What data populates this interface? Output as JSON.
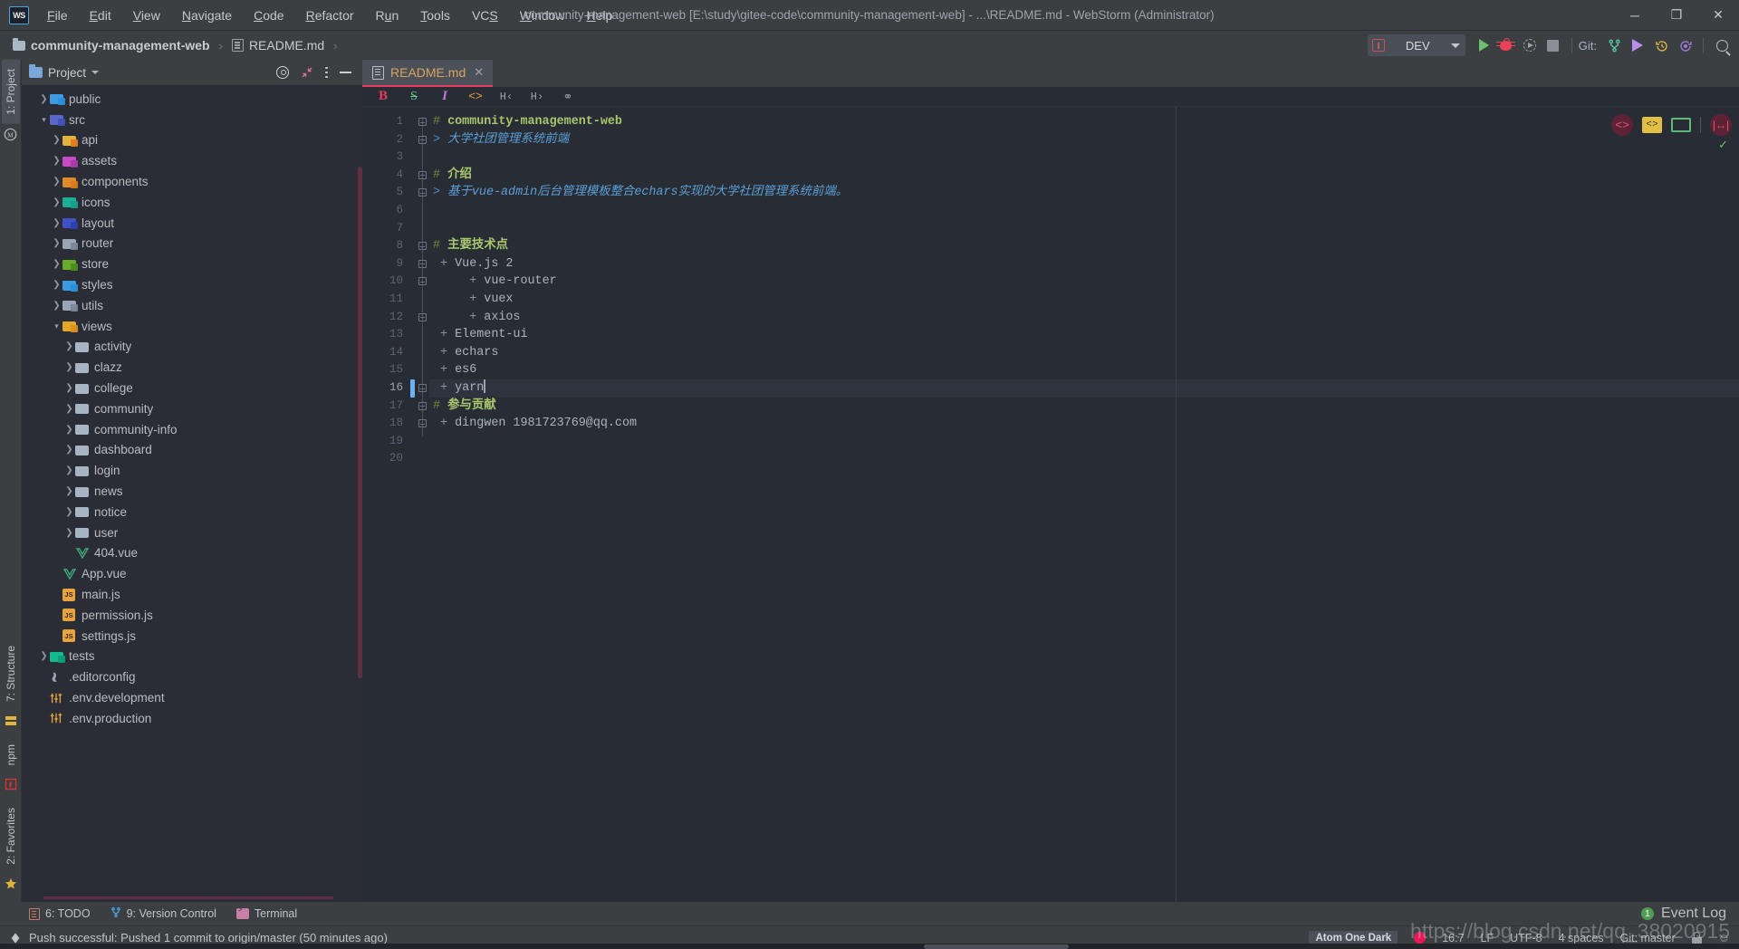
{
  "window": {
    "title": "community-management-web [E:\\study\\gitee-code\\community-management-web] - ...\\README.md - WebStorm (Administrator)",
    "logo": "WS",
    "minimize": "─",
    "maximize": "❐",
    "close": "✕"
  },
  "menubar": [
    {
      "label": "File"
    },
    {
      "label": "Edit"
    },
    {
      "label": "View"
    },
    {
      "label": "Navigate"
    },
    {
      "label": "Code"
    },
    {
      "label": "Refactor"
    },
    {
      "label": "Run"
    },
    {
      "label": "Tools"
    },
    {
      "label": "VCS"
    },
    {
      "label": "Window"
    },
    {
      "label": "Help"
    }
  ],
  "breadcrumb": {
    "project": "community-management-web",
    "file": "README.md",
    "sep": "›"
  },
  "toolbar": {
    "run_config": "DEV",
    "git_label": "Git:",
    "icons": [
      "run-icon",
      "debug-icon",
      "coverage-icon",
      "stop-icon",
      "branch-icon",
      "push-icon",
      "history-icon",
      "revert-icon",
      "search-everywhere-icon"
    ]
  },
  "left_strip": {
    "top": [
      {
        "label": "1: Project",
        "active": true
      }
    ],
    "bottom": [
      {
        "label": "7: Structure"
      },
      {
        "label": "npm"
      },
      {
        "label": "2: Favorites"
      }
    ]
  },
  "project_panel": {
    "title": "Project",
    "actions": [
      "locate-icon",
      "collapse-all-icon",
      "options-icon",
      "hide-icon"
    ],
    "tree": [
      {
        "label": "public",
        "indent": 1,
        "arrow": "closed",
        "icon": "folder",
        "color": "#3d9ae0",
        "badge": "globe"
      },
      {
        "label": "src",
        "indent": 1,
        "arrow": "open",
        "icon": "folder",
        "color": "#5868c9",
        "badge": "code"
      },
      {
        "label": "api",
        "indent": 2,
        "arrow": "closed",
        "icon": "folder",
        "color": "#e0b33d",
        "badge": "dot"
      },
      {
        "label": "assets",
        "indent": 2,
        "arrow": "closed",
        "icon": "folder",
        "color": "#c44bc4",
        "badge": "img"
      },
      {
        "label": "components",
        "indent": 2,
        "arrow": "closed",
        "icon": "folder",
        "color": "#e08b2b",
        "badge": "grid"
      },
      {
        "label": "icons",
        "indent": 2,
        "arrow": "closed",
        "icon": "folder",
        "color": "#1fae93",
        "badge": "cir"
      },
      {
        "label": "layout",
        "indent": 2,
        "arrow": "closed",
        "icon": "folder",
        "color": "#3f51c4",
        "badge": "bars"
      },
      {
        "label": "router",
        "indent": 2,
        "arrow": "closed",
        "icon": "folder",
        "color": "#9aa6b5",
        "badge": "arw"
      },
      {
        "label": "store",
        "indent": 2,
        "arrow": "closed",
        "icon": "folder",
        "color": "#6aab2e",
        "badge": "st"
      },
      {
        "label": "styles",
        "indent": 2,
        "arrow": "closed",
        "icon": "folder",
        "color": "#3d9ae0",
        "badge": "css"
      },
      {
        "label": "utils",
        "indent": 2,
        "arrow": "closed",
        "icon": "folder",
        "color": "#9aa6b5",
        "badge": "ut"
      },
      {
        "label": "views",
        "indent": 2,
        "arrow": "open",
        "icon": "folder",
        "color": "#e0a72b",
        "badge": "vw"
      },
      {
        "label": "activity",
        "indent": 3,
        "arrow": "closed",
        "icon": "folder",
        "color": "#a7b4c4",
        "badge": ""
      },
      {
        "label": "clazz",
        "indent": 3,
        "arrow": "closed",
        "icon": "folder",
        "color": "#a7b4c4",
        "badge": ""
      },
      {
        "label": "college",
        "indent": 3,
        "arrow": "closed",
        "icon": "folder",
        "color": "#a7b4c4",
        "badge": ""
      },
      {
        "label": "community",
        "indent": 3,
        "arrow": "closed",
        "icon": "folder",
        "color": "#a7b4c4",
        "badge": ""
      },
      {
        "label": "community-info",
        "indent": 3,
        "arrow": "closed",
        "icon": "folder",
        "color": "#a7b4c4",
        "badge": ""
      },
      {
        "label": "dashboard",
        "indent": 3,
        "arrow": "closed",
        "icon": "folder",
        "color": "#a7b4c4",
        "badge": ""
      },
      {
        "label": "login",
        "indent": 3,
        "arrow": "closed",
        "icon": "folder",
        "color": "#a7b4c4",
        "badge": ""
      },
      {
        "label": "news",
        "indent": 3,
        "arrow": "closed",
        "icon": "folder",
        "color": "#a7b4c4",
        "badge": ""
      },
      {
        "label": "notice",
        "indent": 3,
        "arrow": "closed",
        "icon": "folder",
        "color": "#a7b4c4",
        "badge": ""
      },
      {
        "label": "user",
        "indent": 3,
        "arrow": "closed",
        "icon": "folder",
        "color": "#a7b4c4",
        "badge": ""
      },
      {
        "label": "404.vue",
        "indent": 3,
        "arrow": "none",
        "icon": "vue",
        "color": "#41b883",
        "badge": ""
      },
      {
        "label": "App.vue",
        "indent": 2,
        "arrow": "none",
        "icon": "vue",
        "color": "#41b883",
        "badge": ""
      },
      {
        "label": "main.js",
        "indent": 2,
        "arrow": "none",
        "icon": "js",
        "color": "#e8a33d",
        "badge": ""
      },
      {
        "label": "permission.js",
        "indent": 2,
        "arrow": "none",
        "icon": "js",
        "color": "#e8a33d",
        "badge": ""
      },
      {
        "label": "settings.js",
        "indent": 2,
        "arrow": "none",
        "icon": "js",
        "color": "#e8a33d",
        "badge": ""
      },
      {
        "label": "tests",
        "indent": 1,
        "arrow": "closed",
        "icon": "folder",
        "color": "#16b891",
        "badge": "ts"
      },
      {
        "label": ".editorconfig",
        "indent": 1,
        "arrow": "none",
        "icon": "cfg",
        "color": "#9aa6b5",
        "badge": ""
      },
      {
        "label": ".env.development",
        "indent": 1,
        "arrow": "none",
        "icon": "env",
        "color": "#e8a33d",
        "badge": ""
      },
      {
        "label": ".env.production",
        "indent": 1,
        "arrow": "none",
        "icon": "env",
        "color": "#e8a33d",
        "badge": ""
      }
    ]
  },
  "editor": {
    "tab": {
      "label": "README.md",
      "close": "✕"
    },
    "md_toolbar": [
      {
        "name": "bold-icon",
        "glyph": "B"
      },
      {
        "name": "strikethrough-icon",
        "glyph": "S"
      },
      {
        "name": "italic-icon",
        "glyph": "I"
      },
      {
        "name": "code-icon",
        "glyph": "<>"
      },
      {
        "name": "header-decrease-icon",
        "glyph": "H‹"
      },
      {
        "name": "header-increase-icon",
        "glyph": "H›"
      },
      {
        "name": "link-icon",
        "glyph": "⚭"
      }
    ],
    "line_numbers": [
      "1",
      "2",
      "3",
      "4",
      "5",
      "6",
      "7",
      "8",
      "9",
      "10",
      "11",
      "12",
      "13",
      "14",
      "15",
      "16",
      "17",
      "18",
      "19",
      "20"
    ],
    "cursor_line": 16,
    "lines": [
      {
        "n": 1,
        "kind": "heading",
        "prefix": "# ",
        "text": "community-management-web"
      },
      {
        "n": 2,
        "kind": "quote",
        "prefix": "> ",
        "text": "大学社团管理系统前端"
      },
      {
        "n": 3,
        "kind": "blank",
        "prefix": "",
        "text": ""
      },
      {
        "n": 4,
        "kind": "heading",
        "prefix": "# ",
        "text": "介绍"
      },
      {
        "n": 5,
        "kind": "quote",
        "prefix": "> ",
        "text": "基于vue-admin后台管理模板整合echars实现的大学社团管理系统前端。"
      },
      {
        "n": 6,
        "kind": "blank",
        "prefix": "",
        "text": ""
      },
      {
        "n": 7,
        "kind": "blank",
        "prefix": "",
        "text": ""
      },
      {
        "n": 8,
        "kind": "heading",
        "prefix": "# ",
        "text": "主要技术点"
      },
      {
        "n": 9,
        "kind": "list",
        "prefix": "+ ",
        "text": "Vue.js 2"
      },
      {
        "n": 10,
        "kind": "list",
        "prefix": "    + ",
        "text": "vue-router"
      },
      {
        "n": 11,
        "kind": "list",
        "prefix": "    + ",
        "text": "vuex"
      },
      {
        "n": 12,
        "kind": "list",
        "prefix": "    + ",
        "text": "axios"
      },
      {
        "n": 13,
        "kind": "list",
        "prefix": "+ ",
        "text": "Element-ui"
      },
      {
        "n": 14,
        "kind": "list",
        "prefix": "+ ",
        "text": "echars"
      },
      {
        "n": 15,
        "kind": "list",
        "prefix": "+ ",
        "text": "es6"
      },
      {
        "n": 16,
        "kind": "list",
        "prefix": "+ ",
        "text": "yarn"
      },
      {
        "n": 17,
        "kind": "heading",
        "prefix": "# ",
        "text": "参与贡献"
      },
      {
        "n": 18,
        "kind": "list",
        "prefix": "+ ",
        "text": "dingwen 1981723769@qq.com"
      },
      {
        "n": 19,
        "kind": "blank",
        "prefix": "",
        "text": ""
      },
      {
        "n": 20,
        "kind": "blank",
        "prefix": "",
        "text": ""
      }
    ],
    "widgets": [
      "code-view-icon",
      "split-view-icon",
      "preview-icon",
      "reader-mode-icon"
    ],
    "inspection_ok": "✓"
  },
  "bottom_bar": {
    "items": [
      {
        "label": "6: TODO",
        "icon": "todo-icon"
      },
      {
        "label": "9: Version Control",
        "icon": "branch-icon"
      },
      {
        "label": "Terminal",
        "icon": "terminal-icon"
      }
    ],
    "event_log": {
      "label": "Event Log",
      "count": "1"
    }
  },
  "status_bar": {
    "message": "Push successful: Pushed 1 commit to origin/master (50 minutes ago)",
    "theme": "Atom One Dark",
    "caret": "16:7",
    "line_separator": "LF",
    "encoding": "UTF-8",
    "indent": "4 spaces",
    "branch": "Git: master"
  },
  "watermark": "https://blog.csdn.net/qq_38020915"
}
